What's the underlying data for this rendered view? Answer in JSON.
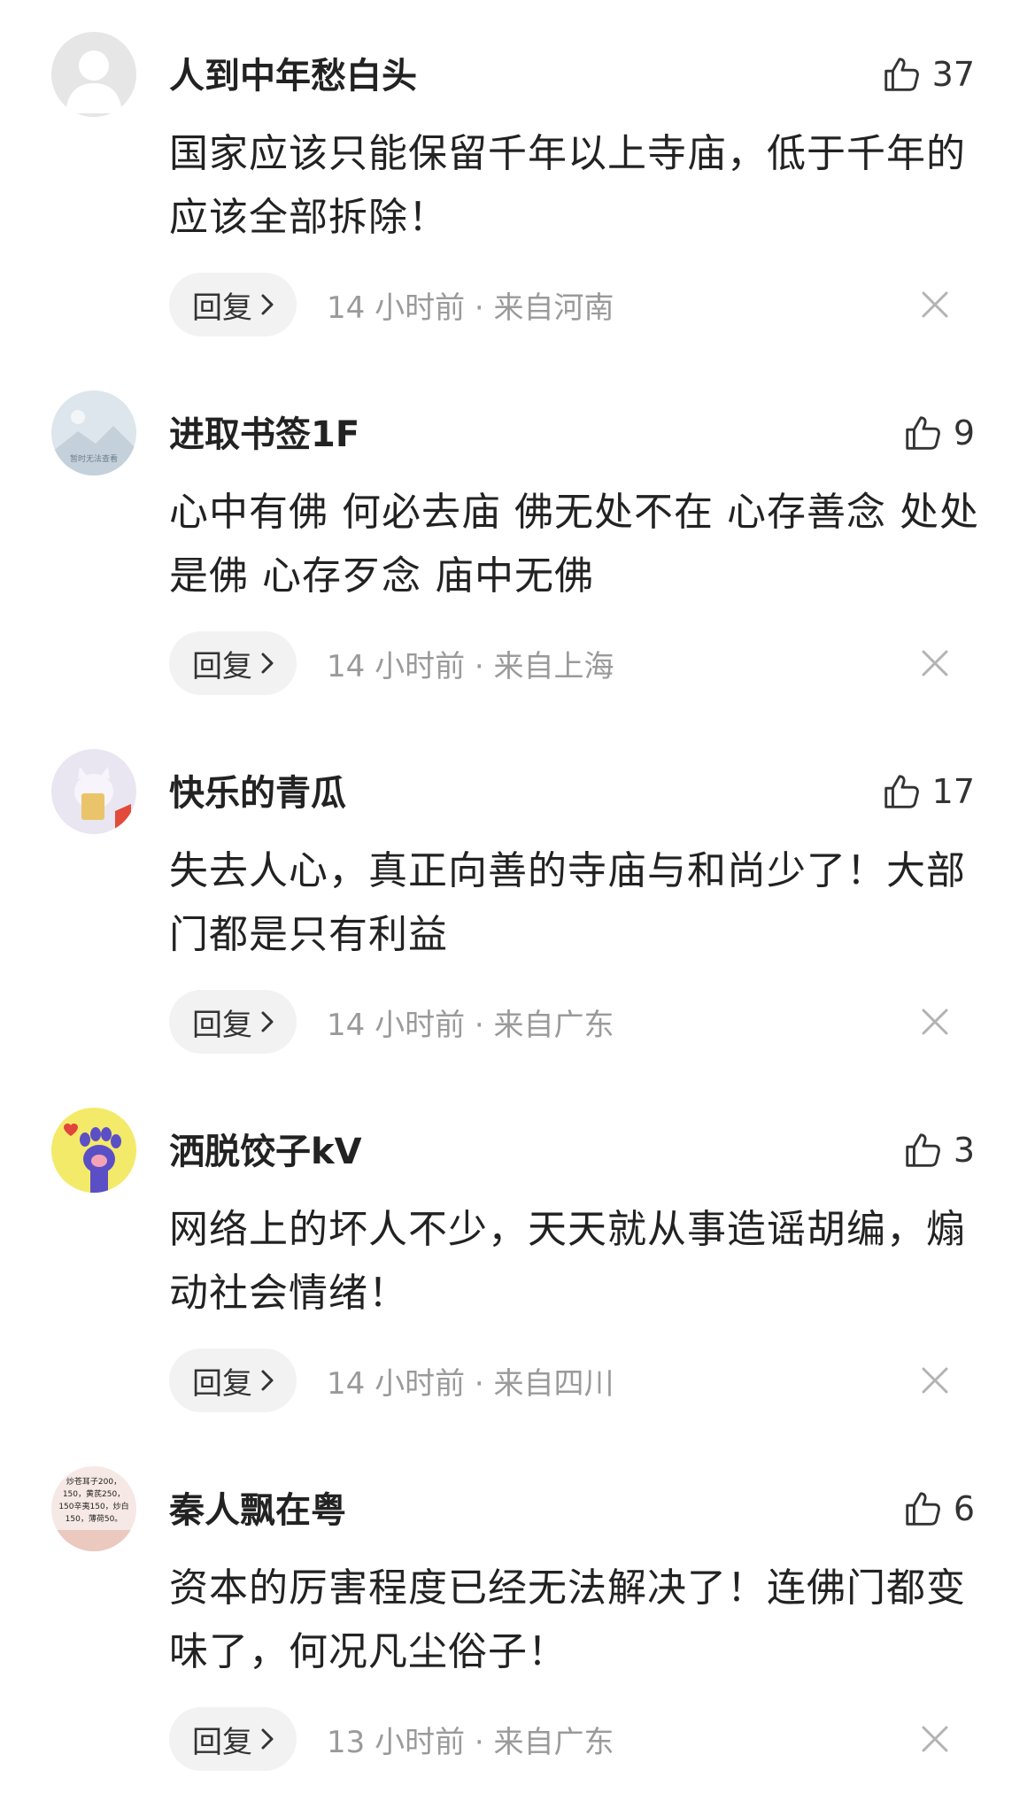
{
  "reply_label": "回复",
  "comments": [
    {
      "username": "人到中年愁白头",
      "likes": "37",
      "content": "国家应该只能保留千年以上寺庙，低于千年的应该全部拆除！",
      "time": "14 小时前 · 来自河南",
      "avatar_icon": "default-person-avatar-icon"
    },
    {
      "username": "进取书签1F",
      "likes": "9",
      "content": "心中有佛 何必去庙 佛无处不在 心存善念 处处是佛 心存歹念 庙中无佛",
      "time": "14 小时前 · 来自上海",
      "avatar_icon": "landscape-placeholder-avatar-icon",
      "avatar_caption": "暂时无法查看"
    },
    {
      "username": "快乐的青瓜",
      "likes": "17",
      "content": "失去人心，真正向善的寺庙与和尚少了！大部门都是只有利益",
      "time": "14 小时前 · 来自广东",
      "avatar_icon": "cartoon-cat-avatar-icon"
    },
    {
      "username": "洒脱饺子kV",
      "likes": "3",
      "content": "网络上的坏人不少，天天就从事造谣胡编，煽动社会情绪！",
      "time": "14 小时前 · 来自四川",
      "avatar_icon": "paw-avatar-icon"
    },
    {
      "username": "秦人飘在粤",
      "likes": "6",
      "content": "资本的厉害程度已经无法解决了！连佛门都变味了，何况凡尘俗子！",
      "time": "13 小时前 · 来自广东",
      "avatar_icon": "price-list-avatar-icon",
      "avatar_text": [
        "炒苍耳子200，",
        "150，黄芪250，",
        "150辛夷150，炒白",
        "150，薄荷50。"
      ]
    }
  ],
  "colors": {
    "background": "#ffffff",
    "text_primary": "#222222",
    "text_secondary": "#9a9a9a",
    "reply_bg": "#f2f2f3",
    "paw_avatar_bg": "#f4ea6a",
    "paw_color": "#5b4fc6"
  }
}
